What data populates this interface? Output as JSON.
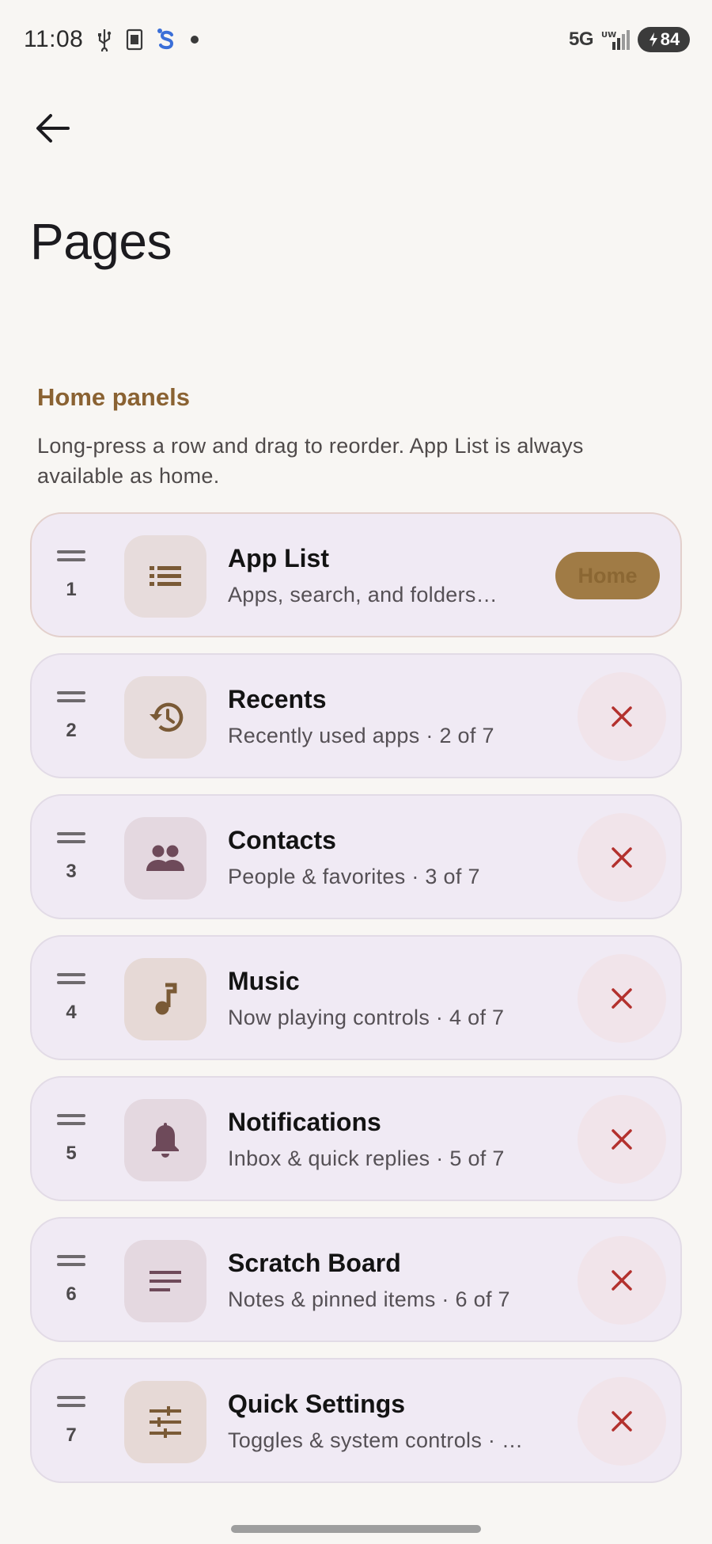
{
  "status_bar": {
    "time": "11:08",
    "network": "5G",
    "network_sup": "UW",
    "battery": "84",
    "notification_dot": "•"
  },
  "header": {
    "title": "Pages"
  },
  "section": {
    "title": "Home panels",
    "description": "Long-press a row and drag to reorder. App List is always available as home."
  },
  "panels": [
    {
      "index": "1",
      "name": "App List",
      "subtitle": "Apps, search, and folders…",
      "icon": "list-icon",
      "action": "Home"
    },
    {
      "index": "2",
      "name": "Recents",
      "subtitle": "Recently used apps · 2 of 7",
      "icon": "history-icon"
    },
    {
      "index": "3",
      "name": "Contacts",
      "subtitle": "People & favorites · 3 of 7",
      "icon": "people-icon"
    },
    {
      "index": "4",
      "name": "Music",
      "subtitle": "Now playing controls · 4 of 7",
      "icon": "music-note-icon"
    },
    {
      "index": "5",
      "name": "Notifications",
      "subtitle": "Inbox & quick replies · 5 of 7",
      "icon": "bell-icon"
    },
    {
      "index": "6",
      "name": "Scratch Board",
      "subtitle": "Notes & pinned items · 6 of 7",
      "icon": "notes-icon"
    },
    {
      "index": "7",
      "name": "Quick Settings",
      "subtitle": "Toggles & system controls · …",
      "icon": "tune-icon"
    }
  ],
  "colors": {
    "accent": "#8a6232",
    "home_chip": "#a07b45",
    "remove_icon": "#b3312e",
    "row_background": "#f0eaf4",
    "icon_box": "#e7dcdc"
  }
}
